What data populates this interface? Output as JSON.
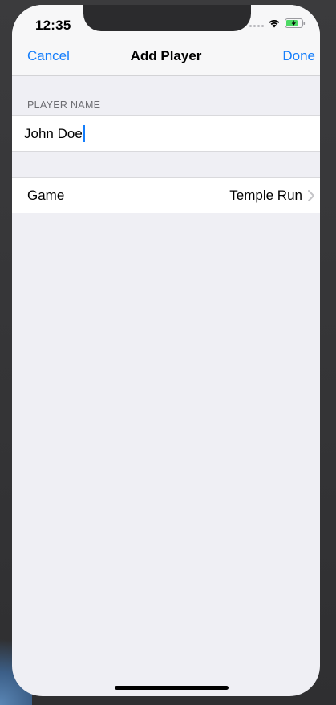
{
  "status_bar": {
    "time": "12:35"
  },
  "nav": {
    "cancel_label": "Cancel",
    "title": "Add Player",
    "done_label": "Done"
  },
  "form": {
    "section_header": "PLAYER NAME",
    "player_name_value": "John Doe",
    "game_label": "Game",
    "game_value": "Temple Run"
  },
  "icons": {
    "wifi": "wifi-icon",
    "battery": "battery-charging-icon",
    "chevron": "chevron-right-icon",
    "signal": "cellular-signal-icon"
  },
  "colors": {
    "accent": "#157efb",
    "background": "#efeff4",
    "nav_background": "#f7f7f8"
  }
}
